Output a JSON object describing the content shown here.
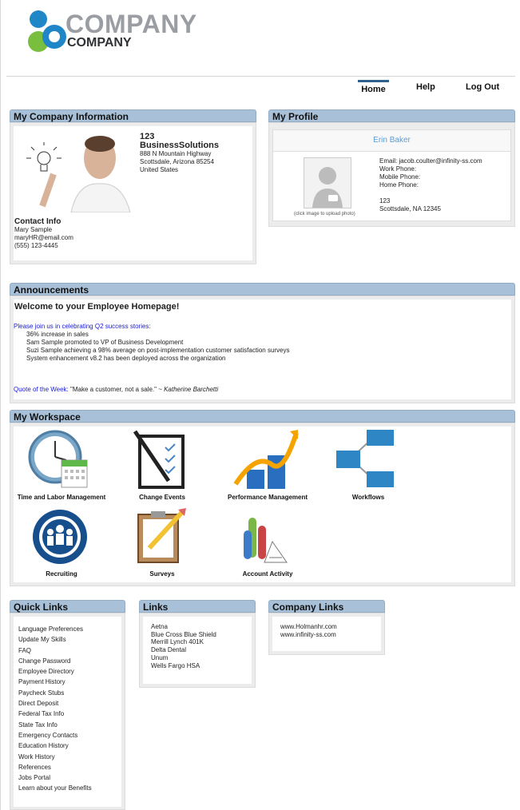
{
  "brand": {
    "line1": "COMPANY",
    "line2": "COMPANY",
    "colors": {
      "blue": "#1f86c8",
      "green": "#79be3f",
      "gray": "#9a9ea3"
    }
  },
  "nav": {
    "home": "Home",
    "help": "Help",
    "logout": "Log Out"
  },
  "company_info": {
    "title": "My Company Information",
    "company_number": "123",
    "company_name": "BusinessSolutions",
    "address1": "888 N Mountain Highway",
    "address2": "Scottsdale, Arizona 85254",
    "country": "United States",
    "contact_title": "Contact Info",
    "contact_name": "Mary Sample",
    "contact_email": "maryHR@email.com",
    "contact_phone": "(555) 123-4445"
  },
  "profile": {
    "title": "My Profile",
    "name": "Erin Baker",
    "email": "Email:  jacob.coulter@infinity-ss.com",
    "work_phone": "Work Phone:",
    "mobile_phone": "Mobile Phone:",
    "home_phone": "Home Phone:",
    "addr1": "123",
    "addr2": "Scottsdale, NA 12345",
    "upload_hint": "(click image to upload photo)"
  },
  "announcements": {
    "title": "Announcements",
    "heading": "Welcome to your Employee Homepage!",
    "intro": "Please join us in celebrating Q2 success stories:",
    "items": [
      "36% increase in sales",
      "Sam Sample promoted to VP of Business Development",
      "Suzi Sample achieving a 98% average on post-implementation customer satisfaction surveys",
      "System enhancement v8.2 has been deployed across the organization"
    ],
    "quote_label": "Quote of the Week:",
    "quote_text": "\"Make a customer, not a sale.\" ~ ",
    "quote_author": "Katherine Barchetti"
  },
  "workspace": {
    "title": "My Workspace",
    "items": [
      {
        "label": "Time and Labor Management",
        "icon": "clock-calendar-icon"
      },
      {
        "label": "Change Events",
        "icon": "clipboard-checklist-icon"
      },
      {
        "label": "Performance Management",
        "icon": "bar-chart-arrow-icon"
      },
      {
        "label": "Workflows",
        "icon": "workflow-diagram-icon"
      },
      {
        "label": "Recruiting",
        "icon": "people-group-icon"
      },
      {
        "label": "Surveys",
        "icon": "clipboard-pencil-icon"
      },
      {
        "label": "Account Activity",
        "icon": "pie-chart-icon"
      }
    ]
  },
  "quick_links": {
    "title": "Quick Links",
    "items": [
      "Language Preferences",
      "Update My Skills",
      "FAQ",
      "Change Password",
      "Employee Directory",
      "Payment History",
      "Paycheck Stubs",
      "Direct Deposit",
      "Federal Tax Info",
      "State Tax Info",
      "Emergency Contacts",
      "Education History",
      "Work History",
      "References",
      "Jobs Portal",
      "Learn about your Benefits"
    ]
  },
  "links": {
    "title": "Links",
    "items": [
      "Aetna",
      "Blue Cross Blue Shield",
      "Merrill Lynch 401K",
      "Delta Dental",
      "Unum",
      "Wells Fargo HSA"
    ]
  },
  "company_links": {
    "title": "Company Links",
    "items": [
      "www.Holmanhr.com",
      "www.infinity-ss.com"
    ]
  }
}
